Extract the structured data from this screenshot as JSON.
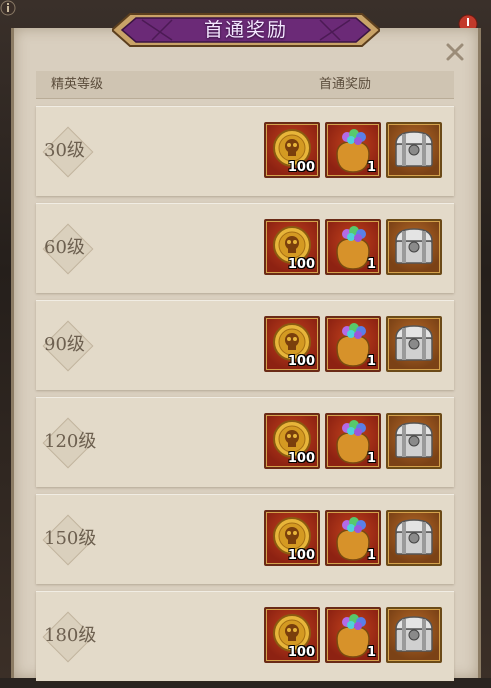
{
  "dialog": {
    "title": "首通奖励",
    "close_icon": "close-icon"
  },
  "table": {
    "col_level": "精英等级",
    "col_reward": "首通奖励"
  },
  "tiers": [
    {
      "level": "30级",
      "rewards": [
        {
          "icon": "gold-skull-coin-icon",
          "qty": "100"
        },
        {
          "icon": "gem-bag-icon",
          "qty": "1"
        },
        {
          "icon": "silver-chest-icon",
          "qty": ""
        }
      ]
    },
    {
      "level": "60级",
      "rewards": [
        {
          "icon": "gold-skull-coin-icon",
          "qty": "100"
        },
        {
          "icon": "gem-bag-icon",
          "qty": "1"
        },
        {
          "icon": "silver-chest-icon",
          "qty": ""
        }
      ]
    },
    {
      "level": "90级",
      "rewards": [
        {
          "icon": "gold-skull-coin-icon",
          "qty": "100"
        },
        {
          "icon": "gem-bag-icon",
          "qty": "1"
        },
        {
          "icon": "silver-chest-icon",
          "qty": ""
        }
      ]
    },
    {
      "level": "120级",
      "rewards": [
        {
          "icon": "gold-skull-coin-icon",
          "qty": "100"
        },
        {
          "icon": "gem-bag-icon",
          "qty": "1"
        },
        {
          "icon": "silver-chest-icon",
          "qty": ""
        }
      ]
    },
    {
      "level": "150级",
      "rewards": [
        {
          "icon": "gold-skull-coin-icon",
          "qty": "100"
        },
        {
          "icon": "gem-bag-icon",
          "qty": "1"
        },
        {
          "icon": "silver-chest-icon",
          "qty": ""
        }
      ]
    },
    {
      "level": "180级",
      "rewards": [
        {
          "icon": "gold-skull-coin-icon",
          "qty": "100"
        },
        {
          "icon": "gem-bag-icon",
          "qty": "1"
        },
        {
          "icon": "silver-chest-icon",
          "qty": ""
        }
      ]
    }
  ],
  "colors": {
    "panel": "#d9cfbf",
    "banner": "#6b2a77",
    "reward_frame": "#8d2212"
  }
}
